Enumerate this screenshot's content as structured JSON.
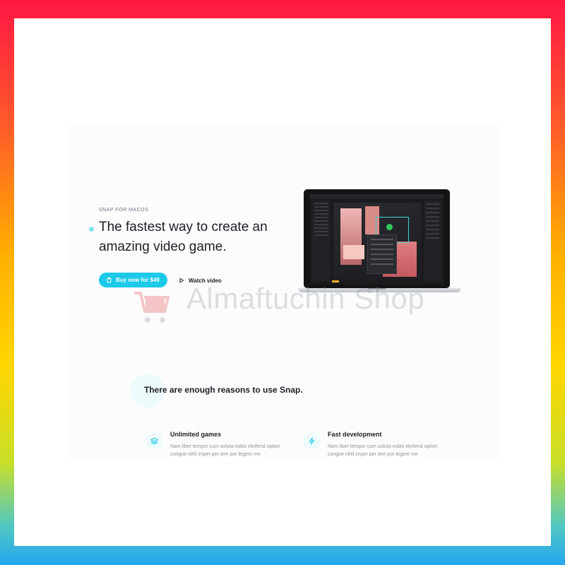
{
  "hero": {
    "eyebrow": "SNAP FOR MACOS",
    "headline": "The fastest way to create an amazing video game.",
    "buy_label": "Buy now for $49",
    "watch_label": "Watch video"
  },
  "watermark": {
    "text": "Almaftuchin Shop"
  },
  "reasons": {
    "title": "There are enough reasons to use Snap.",
    "features": [
      {
        "title": "Unlimited games",
        "text": "Nam liber tempor cum soluta nobis eleifend option congue nihil imper per tem por legere me",
        "icon": "layers-icon"
      },
      {
        "title": "Fast development",
        "text": "Nam liber tempor cum soluta nobis eleifend option congue nihil imper per tem por legere me",
        "icon": "lightning-icon"
      }
    ]
  },
  "colors": {
    "accent": "#1cc9e8",
    "border_top": "#ff1744",
    "border_bottom": "#24a7f2"
  }
}
